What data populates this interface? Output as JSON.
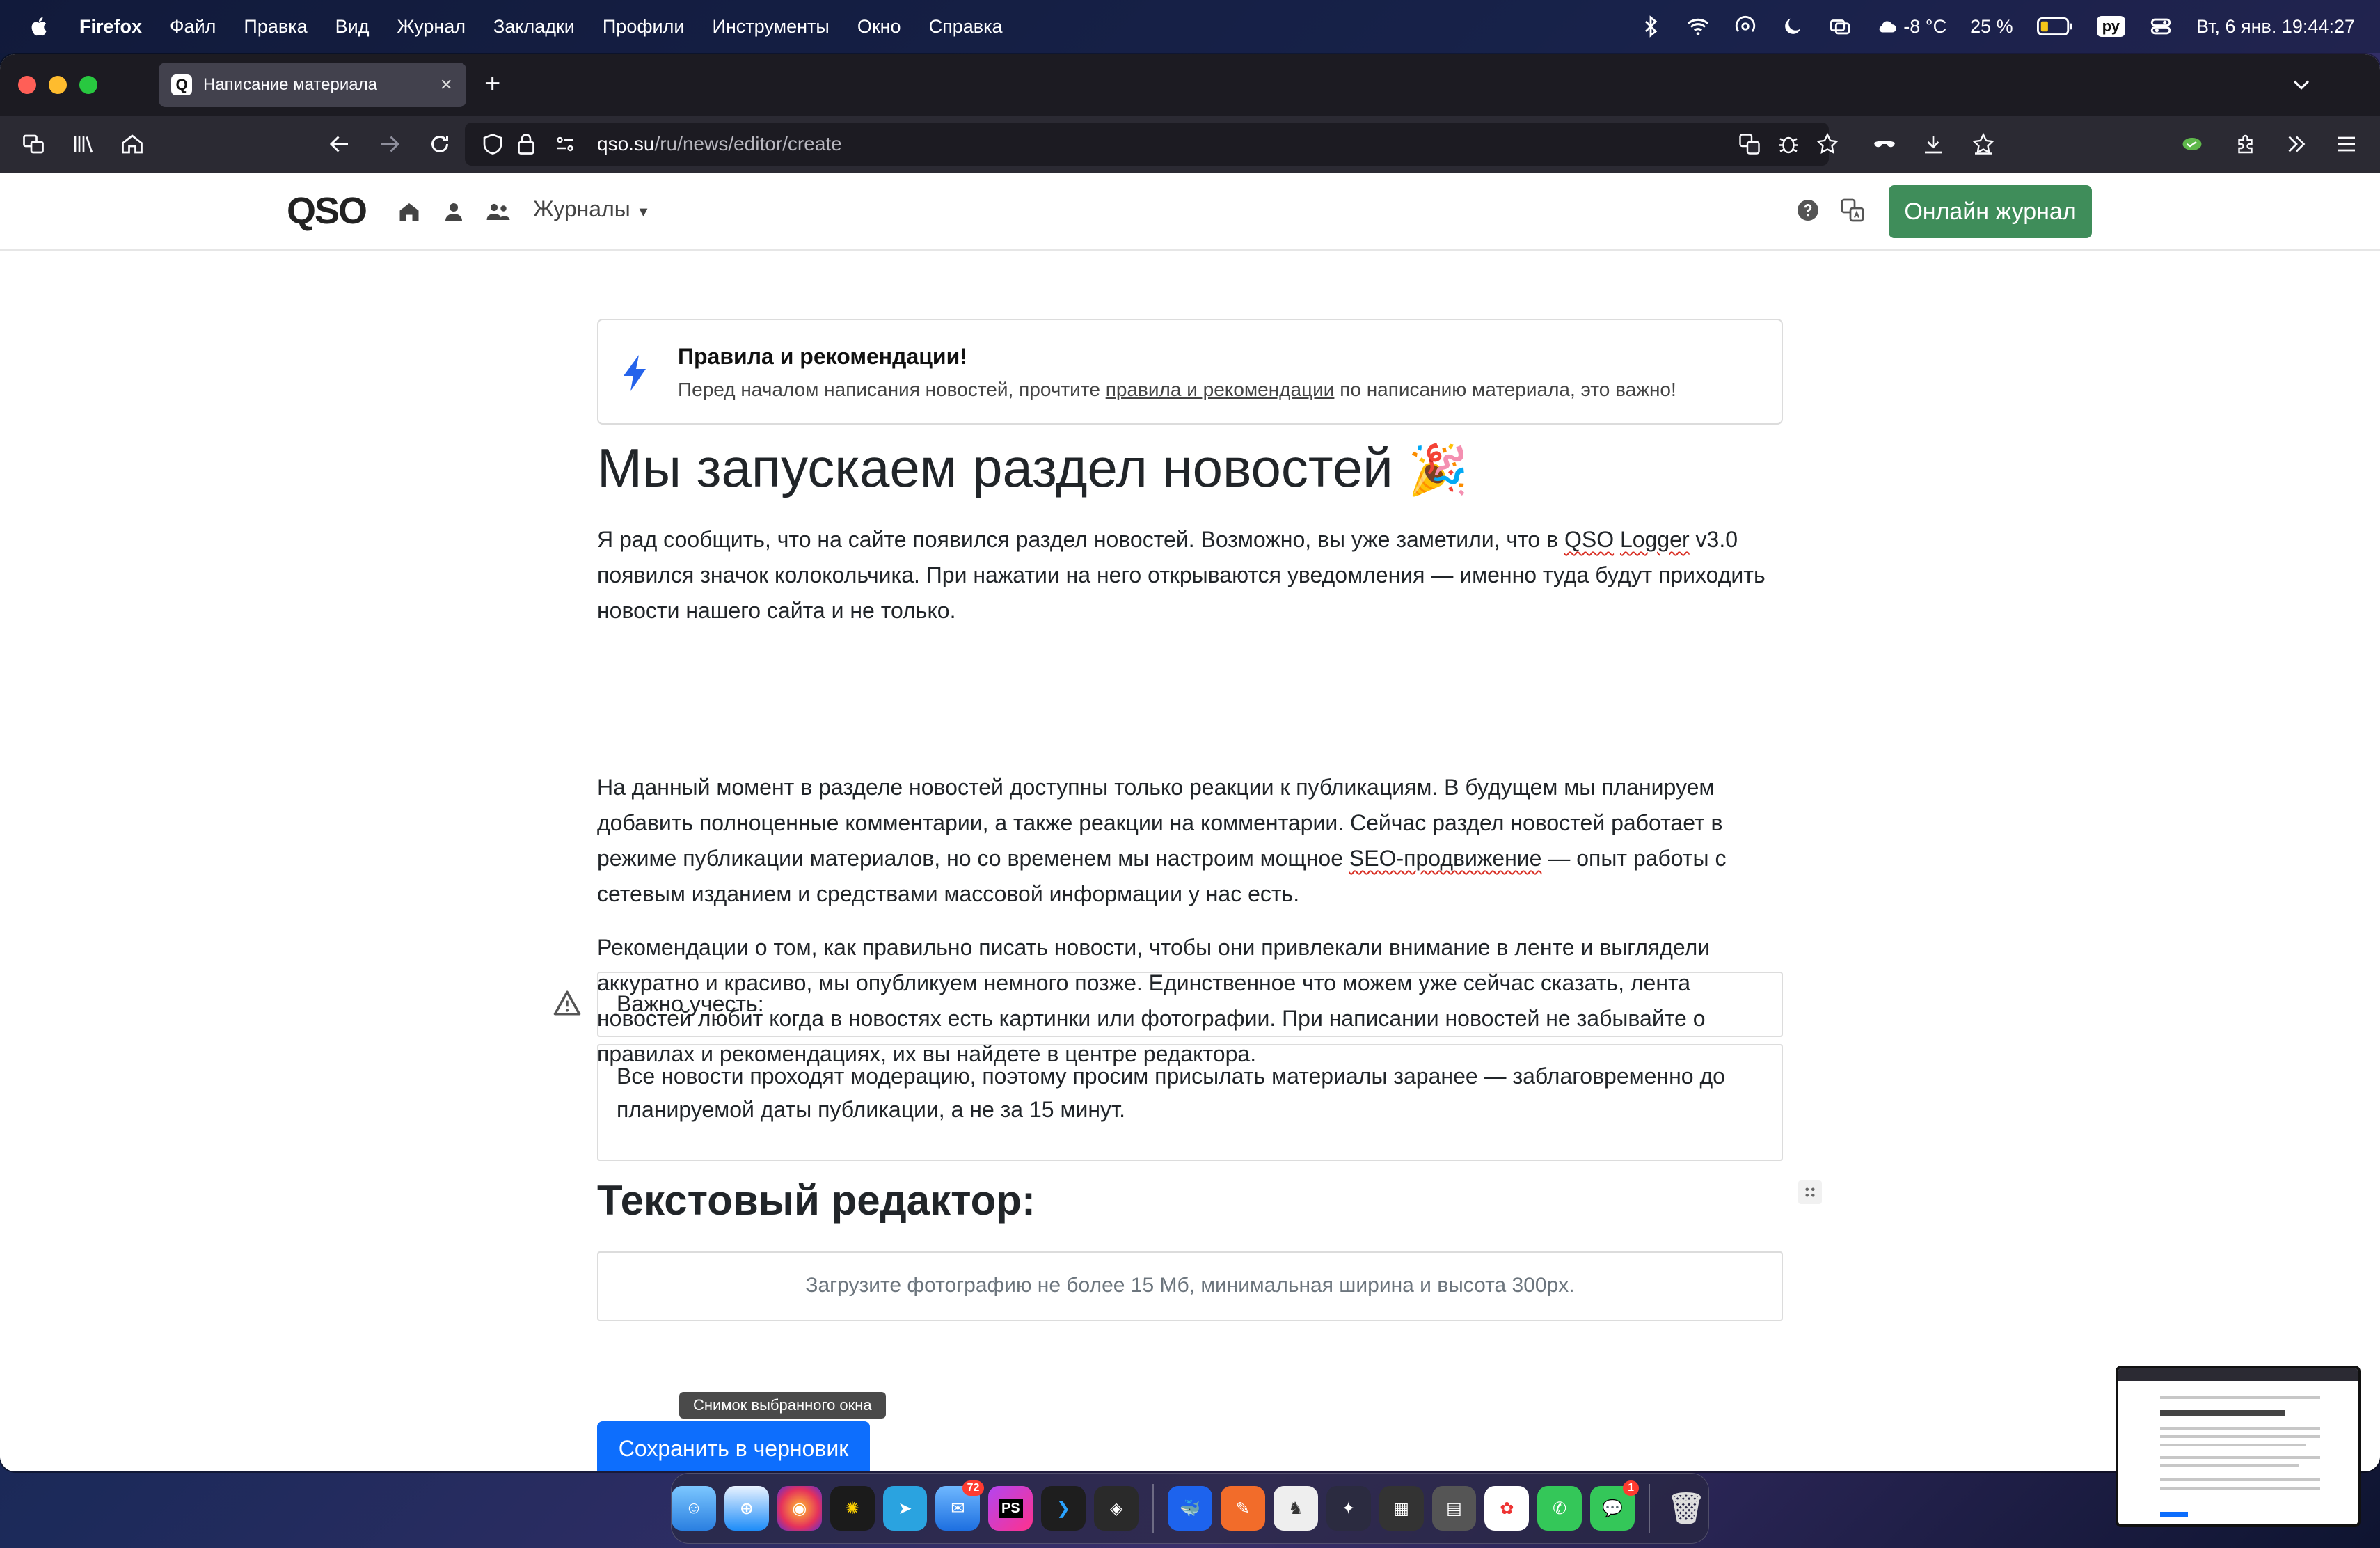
{
  "menubar": {
    "app": "Firefox",
    "items": [
      "Файл",
      "Правка",
      "Вид",
      "Журнал",
      "Закладки",
      "Профили",
      "Инструменты",
      "Окно",
      "Справка"
    ],
    "weather": "-8 °C",
    "battery": "25 %",
    "input_source": "ру",
    "datetime": "Вт, 6 янв.  19:44:27"
  },
  "browser": {
    "tab_title": "Написание материала",
    "tab_favicon": "Q",
    "url_host": "qso.su",
    "url_path": "/ru/news/editor/create"
  },
  "site": {
    "logo": "QSO",
    "journals_label": "Журналы",
    "online_button": "Онлайн журнал",
    "rules": {
      "title": "Правила и рекомендации!",
      "text_before": "Перед началом написания новостей, прочтите ",
      "link": "правила и рекомендации",
      "text_after": " по написанию материала, это важно!"
    },
    "article": {
      "title": "Мы запускаем раздел новостей",
      "title_emoji": "🎉",
      "p1_a": "Я рад сообщить, что на сайте появился раздел новостей. Возможно, вы уже заметили, что в ",
      "p1_b": "QSO",
      "p1_c": " ",
      "p1_d": "Logger",
      "p1_e": " v3.0 появился значок колокольчика. При нажатии на него открываются уведомления — именно туда будут приходить новости нашего сайта и не только.",
      "p2_a": "На данный момент в разделе новостей доступны только реакции к публикациям. В будущем мы планируем добавить полноценные комментарии, а также реакции на комментарии. Сейчас раздел новостей работает в режиме публикации материалов, но со временем мы настроим мощное ",
      "p2_b": "SEO-продвижение",
      "p2_c": " — опыт работы с сетевым изданием и средствами массовой информации у нас есть.",
      "p3": "Рекомендации о том, как правильно писать новости, чтобы они привлекали внимание в ленте и выглядели аккуратно и красиво, мы опубликуем немного позже. Единственное что можем уже сейчас сказать, лента новостей любит когда в новостях есть картинки или фотографии. При написании новостей не забывайте о правилах и рекомендациях, их вы найдете в центре редактора.",
      "warning_title": "Важно учесть:",
      "warning_text": "Все новости проходят модерацию, поэтому просим присылать материалы заранее — заблаговременно до планируемой даты публикации, а не за 15 минут.",
      "editor_heading": "Текстовый редактор:",
      "upload_hint": "Загрузите фотографию не более 15 Мб, минимальная ширина и высота 300px."
    },
    "tooltip": "Снимок выбранного окна",
    "save_button": "Сохранить в черновик"
  },
  "dock": {
    "mail_badge": "72",
    "messages_badge": "1"
  },
  "colors": {
    "primary": "#0d6efd",
    "success": "#3f8d5a",
    "bolt": "#2563eb"
  }
}
